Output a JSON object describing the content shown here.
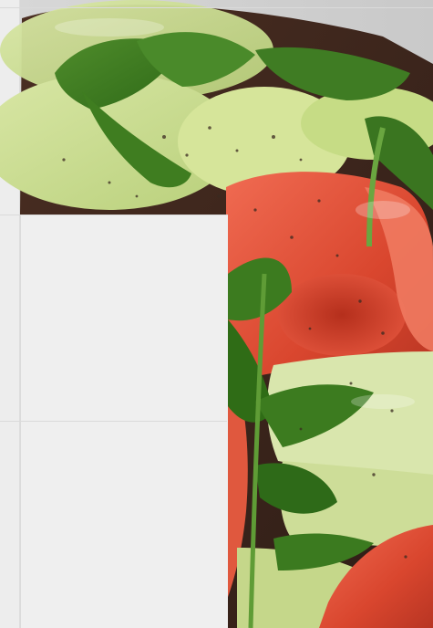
{
  "window": {
    "title": ""
  },
  "image": {
    "alt": "",
    "subject_icon": "photo-icon"
  },
  "colors": {
    "background": "#ececec",
    "panel": "#efefef",
    "divider": "#dadada"
  }
}
